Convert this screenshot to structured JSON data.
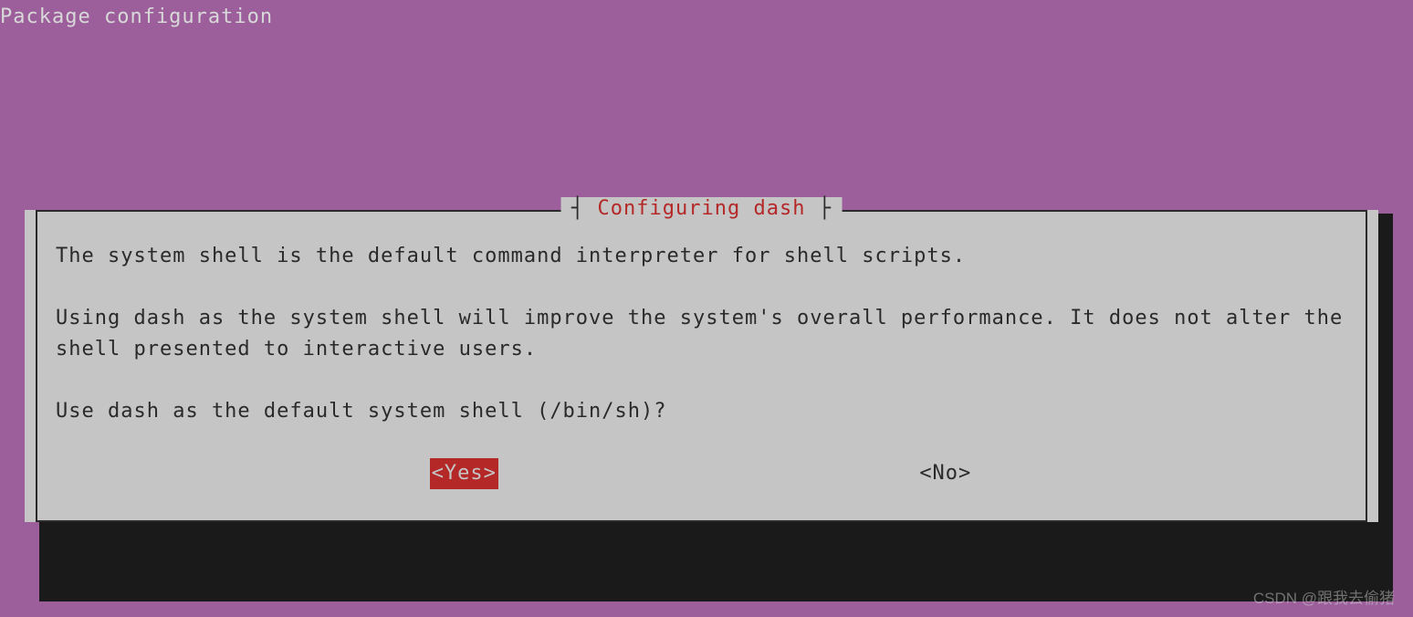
{
  "header": {
    "title": "Package configuration"
  },
  "dialog": {
    "title": "Configuring dash",
    "text_line1": "The system shell is the default command interpreter for shell scripts.",
    "text_line2": "Using dash as the system shell will improve the system's overall performance. It does not alter the shell presented to interactive users.",
    "question": "Use dash as the default system shell (/bin/sh)?",
    "yes_label": "<Yes>",
    "no_label": "<No>"
  },
  "watermark": "CSDN @跟我去偷猪"
}
